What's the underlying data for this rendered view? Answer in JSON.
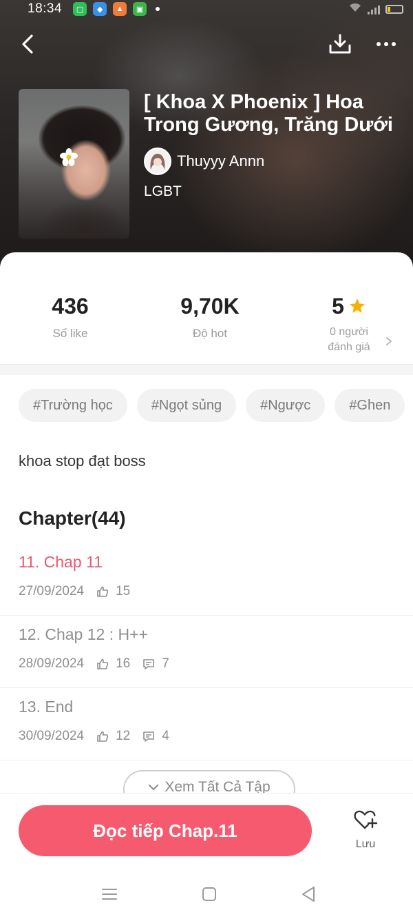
{
  "status_bar": {
    "time": "18:34"
  },
  "header": {
    "back_icon": "chevron-left-icon",
    "download_icon": "download-icon",
    "more_icon": "more-horizontal-icon"
  },
  "story": {
    "title": "[ Khoa X Phoenix ] Hoa\nTrong Gương, Trăng Dưới ...",
    "author": "Thuyyy Annn",
    "genre": "LGBT"
  },
  "stats": {
    "likes_value": "436",
    "likes_label": "Số like",
    "hot_value": "9,70K",
    "hot_label": "Độ hot",
    "rating_value": "5",
    "rating_label_line1": "0 người",
    "rating_label_line2": "đánh giá"
  },
  "tags": [
    "#Trường học",
    "#Ngọt sủng",
    "#Ngược",
    "#Ghen"
  ],
  "description": "khoa stop đạt boss",
  "chapters_heading": "Chapter(44)",
  "chapters": [
    {
      "title": "11. Chap 11",
      "date": "27/09/2024",
      "likes": "15",
      "comments": ""
    },
    {
      "title": "12. Chap 12 : H++",
      "date": "28/09/2024",
      "likes": "16",
      "comments": "7"
    },
    {
      "title": "13. End",
      "date": "30/09/2024",
      "likes": "12",
      "comments": "4"
    }
  ],
  "see_all_label": "Xem Tất Cả Tập",
  "read_button_label": "Đọc tiếp Chap.11",
  "save_label": "Lưu",
  "colors": {
    "accent": "#f65a6e",
    "current_chapter": "#e85a70",
    "star": "#f5b100"
  }
}
